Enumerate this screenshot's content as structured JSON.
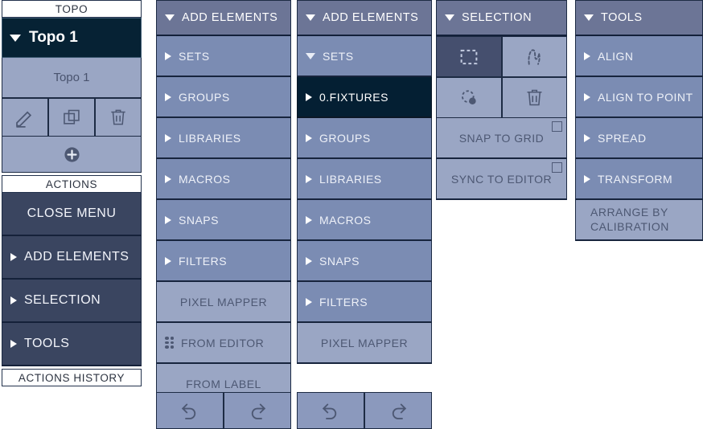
{
  "topo_panel": {
    "section_title": "TOPO",
    "selected": {
      "label": "Topo 1",
      "caret": "chevron-down-icon"
    },
    "name_field": "Topo 1",
    "icons": [
      {
        "name": "edit-pencil-icon"
      },
      {
        "name": "duplicate-icon"
      },
      {
        "name": "delete-trash-icon"
      }
    ],
    "add_button": "add-plus-icon",
    "actions_title": "ACTIONS",
    "actions": [
      {
        "label": "CLOSE MENU",
        "caret": false
      },
      {
        "label": "ADD ELEMENTS",
        "caret": true
      },
      {
        "label": "SELECTION",
        "caret": true
      },
      {
        "label": "TOOLS",
        "caret": true
      }
    ],
    "history_title": "ACTIONS HISTORY"
  },
  "add_elements_1": {
    "header": "ADD ELEMENTS",
    "items": [
      {
        "label": "SETS",
        "caret": "right",
        "style": "normal"
      },
      {
        "label": "GROUPS",
        "caret": "right",
        "style": "normal"
      },
      {
        "label": "LIBRARIES",
        "caret": "right",
        "style": "normal"
      },
      {
        "label": "MACROS",
        "caret": "right",
        "style": "normal"
      },
      {
        "label": "SNAPS",
        "caret": "right",
        "style": "normal"
      },
      {
        "label": "FILTERS",
        "caret": "right",
        "style": "normal"
      },
      {
        "label": "PIXEL MAPPER",
        "caret": "none",
        "style": "light"
      },
      {
        "label": "FROM EDITOR",
        "caret": "dots",
        "style": "light"
      },
      {
        "label": "FROM LABEL",
        "caret": "none",
        "style": "light"
      }
    ],
    "undo_label": "undo-icon",
    "redo_label": "redo-icon"
  },
  "add_elements_2": {
    "header": "ADD ELEMENTS",
    "items": [
      {
        "label": "SETS",
        "caret": "down",
        "style": "normal"
      },
      {
        "label": "0.FIXTURES",
        "caret": "right",
        "style": "dark"
      },
      {
        "label": "GROUPS",
        "caret": "right",
        "style": "normal"
      },
      {
        "label": "LIBRARIES",
        "caret": "right",
        "style": "normal"
      },
      {
        "label": "MACROS",
        "caret": "right",
        "style": "normal"
      },
      {
        "label": "SNAPS",
        "caret": "right",
        "style": "normal"
      },
      {
        "label": "FILTERS",
        "caret": "right",
        "style": "normal"
      },
      {
        "label": "PIXEL MAPPER",
        "caret": "none",
        "style": "light"
      }
    ],
    "undo_label": "undo-icon",
    "redo_label": "redo-icon"
  },
  "selection_panel": {
    "header": "SELECTION",
    "tools": [
      {
        "name": "marquee-rectangle-icon",
        "active": true
      },
      {
        "name": "lasso-freehand-icon",
        "active": false
      },
      {
        "name": "deselect-icon",
        "active": false
      },
      {
        "name": "delete-trash-icon",
        "active": false
      }
    ],
    "toggles": [
      {
        "label": "SNAP TO GRID",
        "checked": false
      },
      {
        "label": "SYNC TO EDITOR",
        "checked": false
      }
    ]
  },
  "tools_panel": {
    "header": "TOOLS",
    "items": [
      {
        "label": "ALIGN",
        "caret": "right",
        "style": "normal"
      },
      {
        "label": "ALIGN TO POINT",
        "caret": "right",
        "style": "normal"
      },
      {
        "label": "SPREAD",
        "caret": "right",
        "style": "normal"
      },
      {
        "label": "TRANSFORM",
        "caret": "right",
        "style": "normal"
      },
      {
        "label": "ARRANGE BY CALIBRATION",
        "caret": "none",
        "style": "light"
      }
    ]
  },
  "colors": {
    "panel_header": "#6c7596",
    "row": "#7b8cb3",
    "row_light": "#9aa6c4",
    "row_dark": "#041f33",
    "action_row": "#3a4560",
    "border": "#1d2b44"
  }
}
